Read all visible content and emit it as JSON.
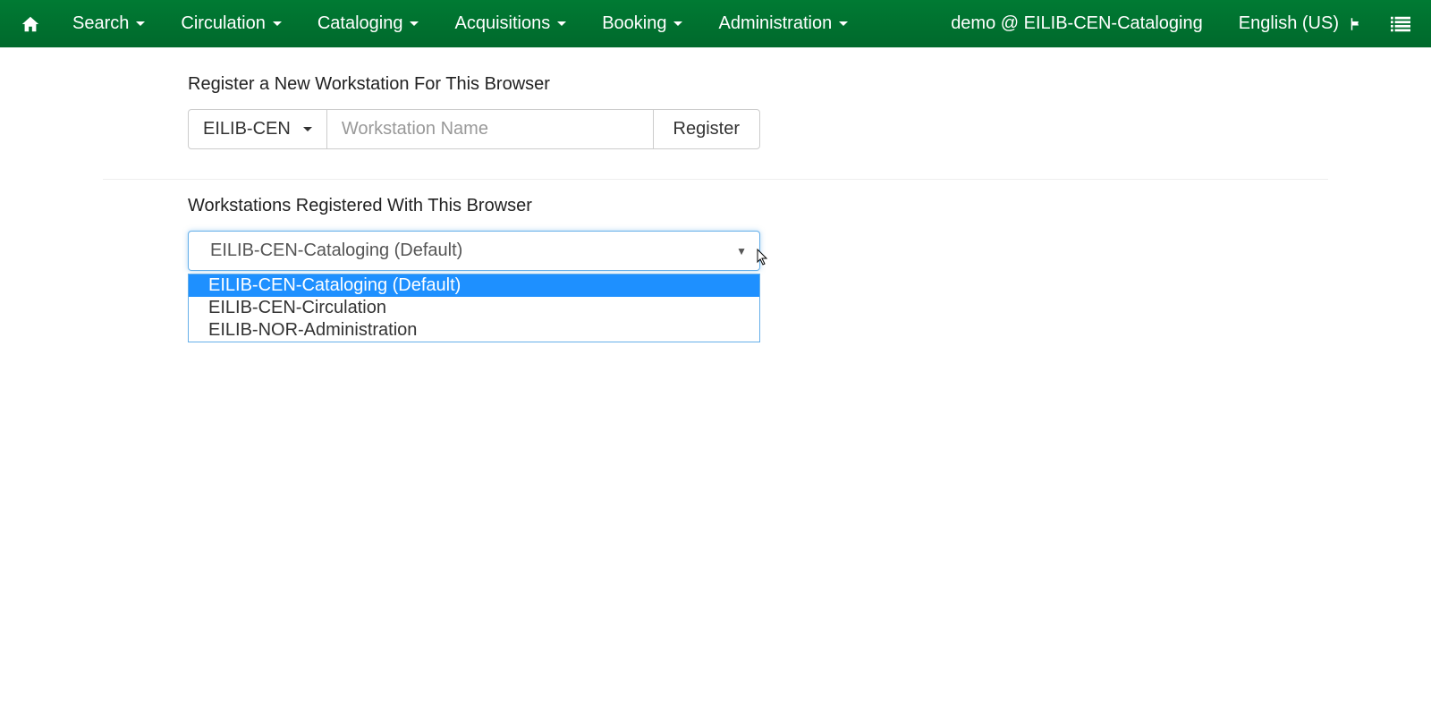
{
  "nav": {
    "items": [
      {
        "label": "Search"
      },
      {
        "label": "Circulation"
      },
      {
        "label": "Cataloging"
      },
      {
        "label": "Acquisitions"
      },
      {
        "label": "Booking"
      },
      {
        "label": "Administration"
      }
    ],
    "user_status": "demo @ EILIB-CEN-Cataloging",
    "language": "English (US)"
  },
  "register": {
    "title": "Register a New Workstation For This Browser",
    "org_selected": "EILIB-CEN",
    "workstation_placeholder": "Workstation Name",
    "register_label": "Register"
  },
  "registered": {
    "title": "Workstations Registered With This Browser",
    "selected": "EILIB-CEN-Cataloging (Default)",
    "options": [
      "EILIB-CEN-Cataloging (Default)",
      "EILIB-CEN-Circulation",
      "EILIB-NOR-Administration"
    ]
  }
}
